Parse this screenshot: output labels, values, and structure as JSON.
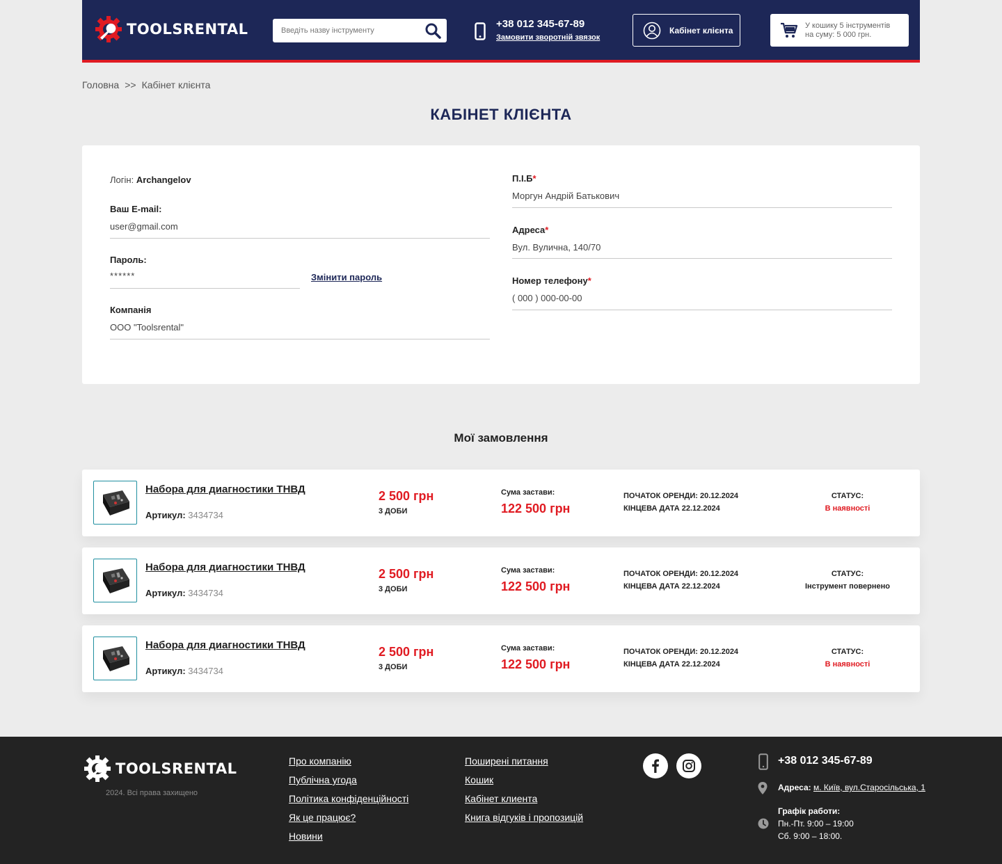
{
  "brand": {
    "name": "TOOLSRENTAL",
    "accent": "#e01b22",
    "navy": "#1d2757"
  },
  "header": {
    "search_placeholder": "Введіть назву інструменту",
    "phone": "+38 012 345-67-89",
    "callback": "Замовити зворотній звязок",
    "cabinet": "Кабінет клієнта",
    "cart_line1": "У кошику 5 інструментів",
    "cart_line2": "на суму: 5 000 грн."
  },
  "breadcrumb": {
    "home": "Головна",
    "sep": ">>",
    "current": "Кабінет клієнта"
  },
  "page_title": "КАБІНЕТ КЛІЄНТА",
  "profile": {
    "login_label": "Логін:",
    "login_value": "Archangelov",
    "email_label": "Ваш E-mail:",
    "email_value": "user@gmail.com",
    "password_label": "Пароль:",
    "password_value": "******",
    "change_password": "Змінити пароль",
    "company_label": "Компанія",
    "company_value": "ООО \"Toolsrental\"",
    "name_label": "П.І.Б",
    "name_value": "Моргун Андрій Батькович",
    "address_label": "Адреса",
    "address_value": "Вул. Вулична, 140/70",
    "phone_label": "Номер телефону",
    "phone_value": "( 000 ) 000-00-00",
    "required_mark": "*"
  },
  "orders_title": "Мої замовлення",
  "orders": [
    {
      "name": "Набора для диагностики ТНВД",
      "article_label": "Артикул:",
      "article": "3434734",
      "price": "2 500 грн",
      "days": "3 ДОБИ",
      "deposit_label": "Сума застави:",
      "deposit": "122 500 грн",
      "start": "ПОЧАТОК ОРЕНДИ: 20.12.2024",
      "end": "КІНЦЕВА ДАТА 22.12.2024",
      "status_label": "СТАТУС:",
      "status": "В наявності"
    },
    {
      "name": "Набора для диагностики ТНВД",
      "article_label": "Артикул:",
      "article": "3434734",
      "price": "2 500 грн",
      "days": "3 ДОБИ",
      "deposit_label": "Сума застави:",
      "deposit": "122 500 грн",
      "start": "ПОЧАТОК ОРЕНДИ: 20.12.2024",
      "end": "КІНЦЕВА ДАТА 22.12.2024",
      "status_label": "СТАТУС:",
      "status": "Інструмент повернено"
    },
    {
      "name": "Набора для диагностики ТНВД",
      "article_label": "Артикул:",
      "article": "3434734",
      "price": "2 500 грн",
      "days": "3 ДОБИ",
      "deposit_label": "Сума застави:",
      "deposit": "122 500 грн",
      "start": "ПОЧАТОК ОРЕНДИ: 20.12.2024",
      "end": "КІНЦЕВА ДАТА 22.12.2024",
      "status_label": "СТАТУС:",
      "status": "В наявності"
    }
  ],
  "footer": {
    "copyright": "2024. Всі права захищено",
    "links_col1": [
      "Про компанію",
      "Публічна угода",
      "Політика конфіденційності",
      "Як це працює?",
      "Новини"
    ],
    "links_col2": [
      "Поширені питання",
      "Кошик",
      "Кабінет клиента",
      "Книга відгуків і пропозицій"
    ],
    "social": [
      "facebook-icon",
      "instagram-icon"
    ],
    "phone": "+38 012 345-67-89",
    "address_label": "Адреса:",
    "address_value": "м. Київ, вул.Старосільська, 1",
    "schedule_label": "Графік работи:",
    "schedule_weekdays": "Пн.-Пт. 9:00 – 19:00",
    "schedule_saturday": "Сб. 9:00 – 18:00."
  }
}
